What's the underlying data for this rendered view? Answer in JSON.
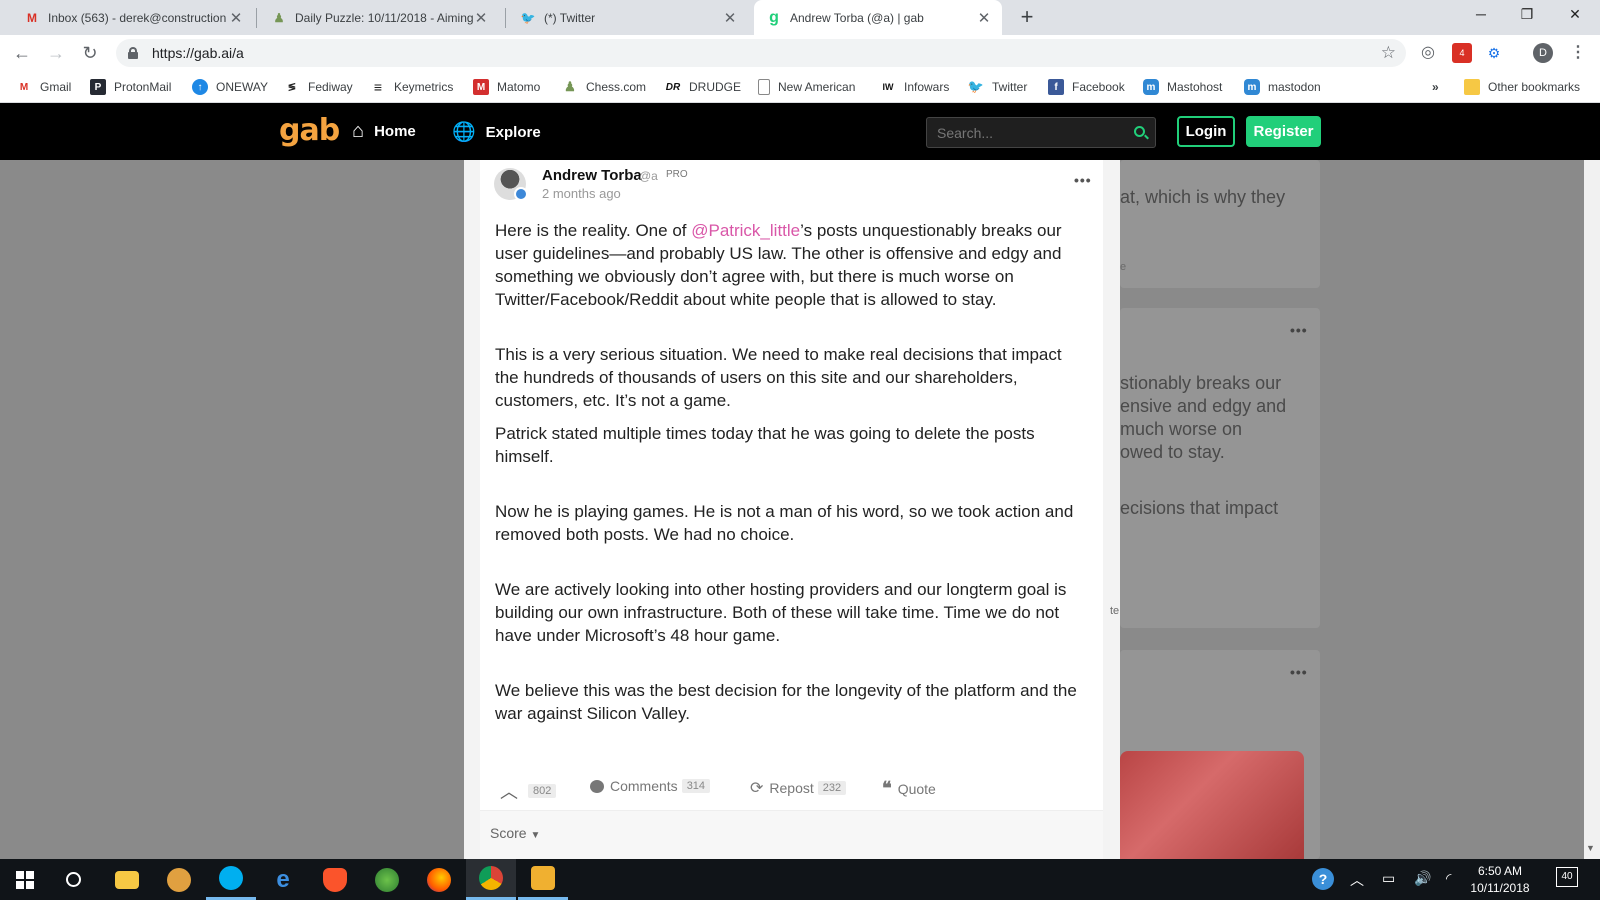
{
  "browser": {
    "tabs": [
      {
        "title": "Inbox (563) - derek@construction",
        "icon": "gmail-icon"
      },
      {
        "title": "Daily Puzzle: 10/11/2018 - Aiming",
        "icon": "chess-icon"
      },
      {
        "title": "(*) Twitter",
        "icon": "twitter-icon"
      },
      {
        "title": "Andrew Torba (@a) | gab",
        "icon": "gab-icon"
      }
    ],
    "url": "https://gab.ai/a",
    "bookmarks": [
      "Gmail",
      "ProtonMail",
      "ONEWAY",
      "Fediway",
      "Keymetrics",
      "Matomo",
      "Chess.com",
      "DRUDGE",
      "New American",
      "Infowars",
      "Twitter",
      "Facebook",
      "Mastohost",
      "mastodon"
    ],
    "bookmarks_overflow": "»",
    "other_bookmarks": "Other bookmarks",
    "profile_initial": "D",
    "extension_badge": "4"
  },
  "gab": {
    "logo": "gab",
    "nav_home": "Home",
    "nav_explore": "Explore",
    "search_placeholder": "Search...",
    "login": "Login",
    "register": "Register"
  },
  "post": {
    "author": "Andrew Torba",
    "handle": "@a",
    "pro": "PRO",
    "time": "2 months ago",
    "p1_before": "Here is the reality. One of ",
    "p1_mention": "@Patrick_little",
    "p1_after": "’s posts unquestionably breaks our user guidelines—and probably US law. The other is offensive and edgy and something we obviously don’t agree with, but there is much worse on Twitter/Facebook/Reddit about white people that is allowed to stay.",
    "p2": "This is a very serious situation. We need to make real decisions that impact the hundreds of thousands of users on this site and our shareholders, customers, etc. It’s not a game.",
    "p3": "Patrick stated multiple times today that he was going to delete the posts himself.",
    "p4": "Now he is playing games. He is not a man of his word, so we took action and removed both posts. We had no choice.",
    "p5": "We are actively looking into other hosting providers and our longterm goal is building our own infrastructure. Both of these will take time. Time we do not have under Microsoft’s 48 hour game.",
    "p6": "We believe this was the best decision for the longevity of the platform and the war against Silicon Valley.",
    "upvotes": "802",
    "comments_label": "Comments",
    "comments_count": "314",
    "repost_label": "Repost",
    "repost_count": "232",
    "quote_label": "Quote",
    "sort_label": "Score"
  },
  "background": {
    "snippet1": "at, which is why they",
    "snippet2": "stionably breaks our",
    "snippet3": "ensive and edgy and",
    "snippet4": "much worse on",
    "snippet5": "owed to stay.",
    "snippet6": "ecisions that impact",
    "faded1": "e",
    "faded2": "te"
  },
  "taskbar": {
    "time": "6:50 AM",
    "date": "10/11/2018",
    "notification_count": "40"
  }
}
